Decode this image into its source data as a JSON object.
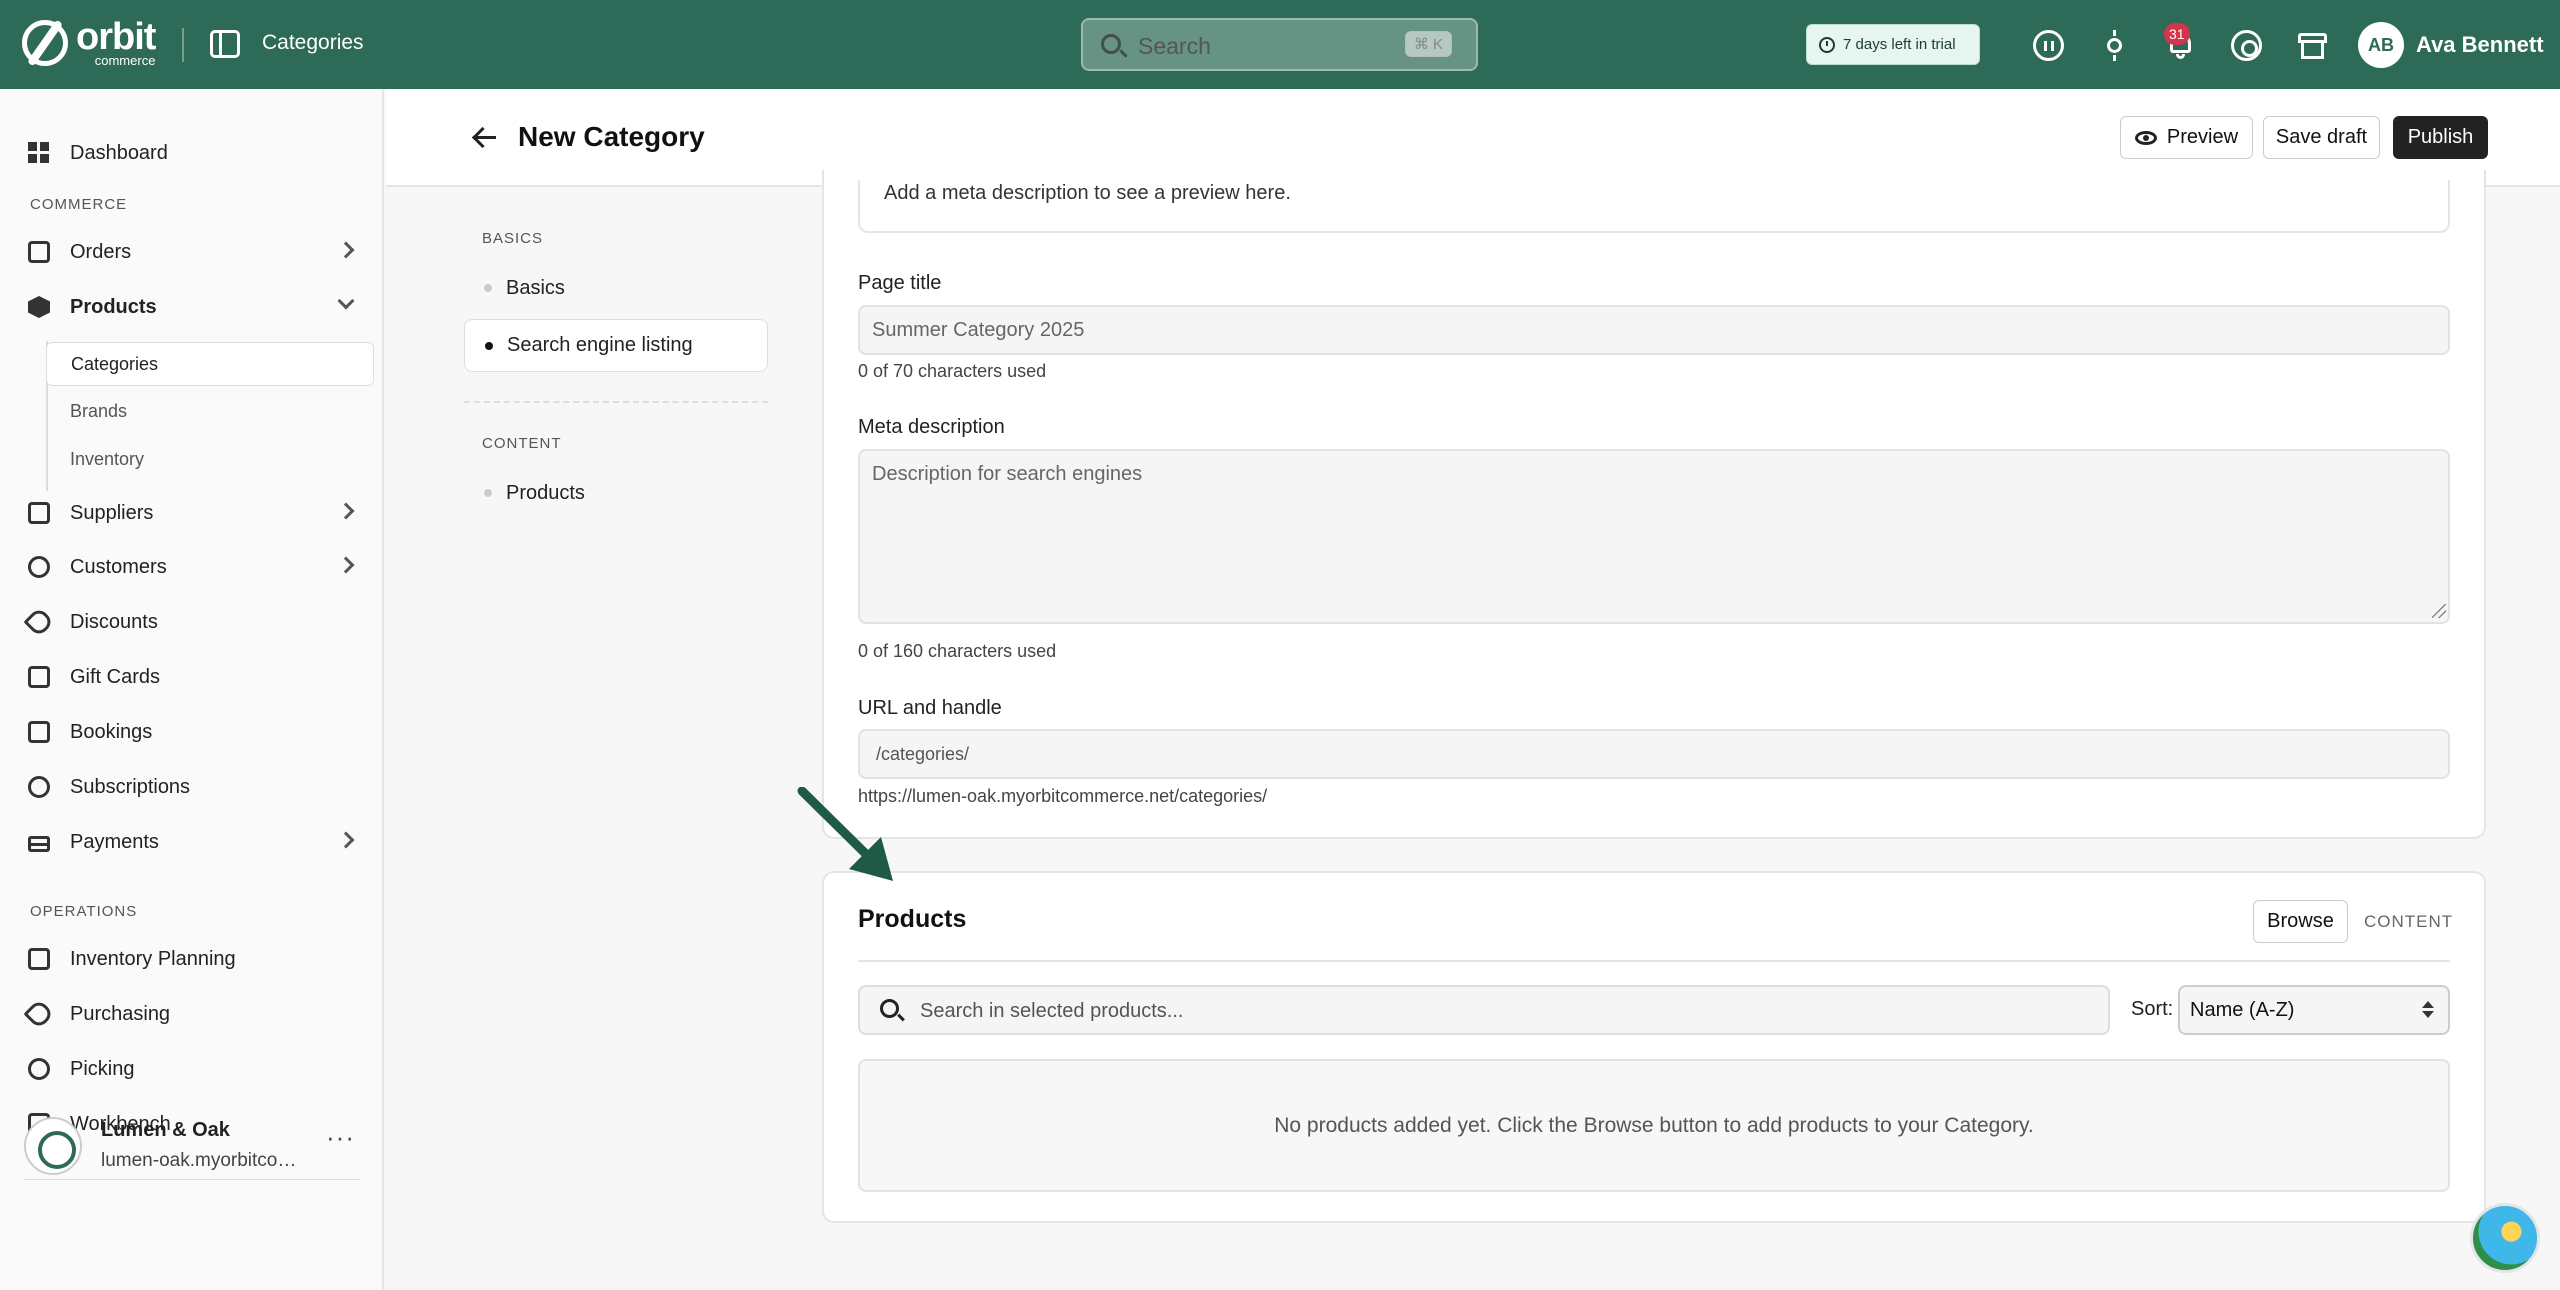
{
  "topbar": {
    "logo_word": "orbit",
    "logo_sub": "commerce",
    "section": "Categories",
    "search_placeholder": "Search",
    "search_shortcut": "⌘ K",
    "trial_text": "7 days left in trial",
    "notification_count": "31",
    "user_initials": "AB",
    "user_name": "Ava Bennett",
    "brand_color": "#2d6a57"
  },
  "sidebar": {
    "dashboard": "Dashboard",
    "group_commerce": "COMMERCE",
    "orders": "Orders",
    "products": "Products",
    "sub_categories": "Categories",
    "sub_brands": "Brands",
    "sub_inventory": "Inventory",
    "suppliers": "Suppliers",
    "customers": "Customers",
    "discounts": "Discounts",
    "gift_cards": "Gift Cards",
    "bookings": "Bookings",
    "subscriptions": "Subscriptions",
    "payments": "Payments",
    "group_operations": "OPERATIONS",
    "inventory_planning": "Inventory Planning",
    "purchasing": "Purchasing",
    "picking": "Picking",
    "workbench": "Workbench",
    "store_name": "Lumen & Oak",
    "store_url": "lumen-oak.myorbitcommerce.net"
  },
  "header": {
    "title": "New Category",
    "preview": "Preview",
    "save_draft": "Save draft",
    "publish": "Publish"
  },
  "section_nav": {
    "group_basics": "BASICS",
    "basics": "Basics",
    "seo": "Search engine listing",
    "group_content": "CONTENT",
    "products": "Products"
  },
  "seo": {
    "preview_hint": "Add a meta description to see a preview here.",
    "page_title_label": "Page title",
    "page_title_placeholder": "Summer Category 2025",
    "page_title_help": "0 of 70 characters used",
    "meta_label": "Meta description",
    "meta_placeholder": "Description for search engines",
    "meta_help": "0 of 160 characters used",
    "url_label": "URL and handle",
    "url_prefix": "/categories/",
    "url_full": "https://lumen-oak.myorbitcommerce.net/categories/"
  },
  "products": {
    "title": "Products",
    "browse": "Browse",
    "content_tab": "CONTENT",
    "search_placeholder": "Search in selected products...",
    "sort_label": "Sort:",
    "sort_value": "Name (A-Z)",
    "empty_message": "No products added yet. Click the Browse button to add products to your Category."
  }
}
